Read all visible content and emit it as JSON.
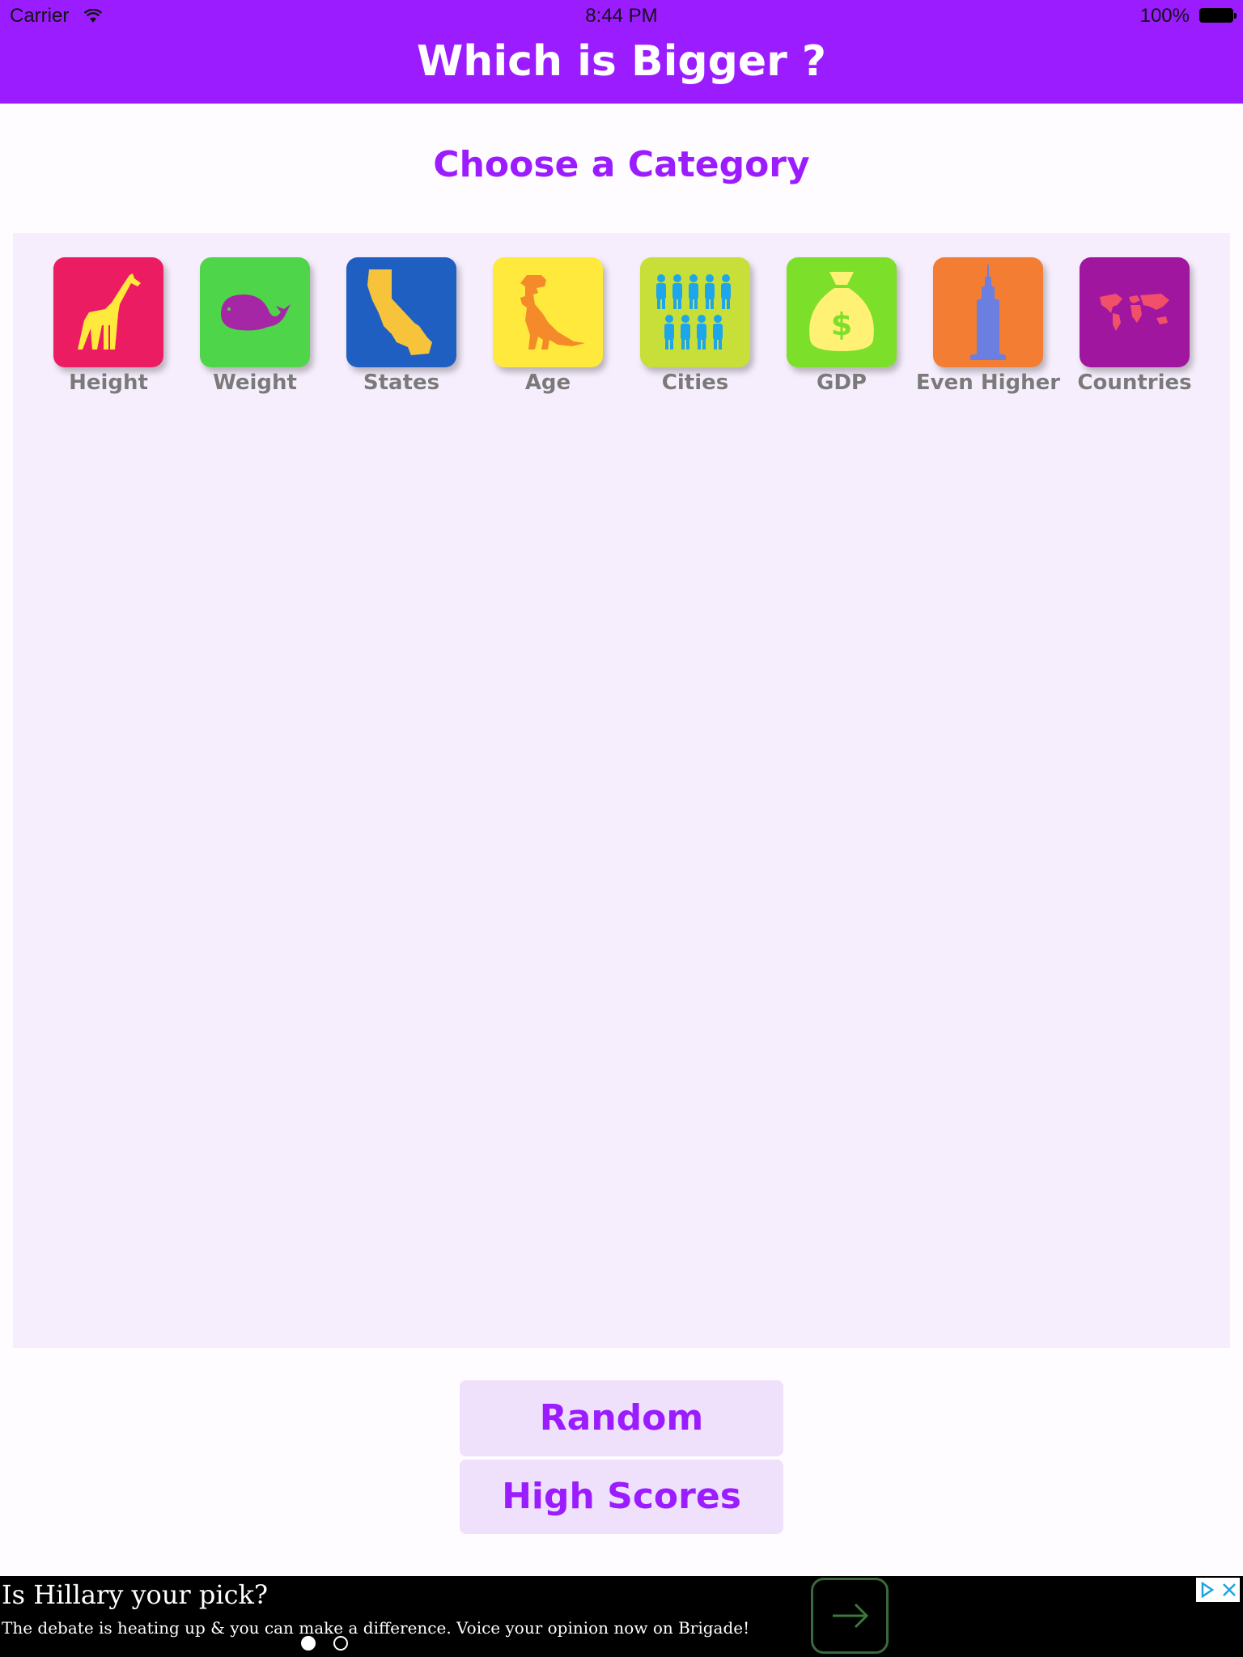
{
  "status_bar": {
    "carrier": "Carrier",
    "time": "8:44 PM",
    "battery": "100%"
  },
  "header": {
    "title": "Which is Bigger ?"
  },
  "subtitle": "Choose a Category",
  "categories": [
    {
      "label": "Height",
      "icon": "giraffe-icon",
      "color": "#ec1c63"
    },
    {
      "label": "Weight",
      "icon": "whale-icon",
      "color": "#4fd54a"
    },
    {
      "label": "States",
      "icon": "california-icon",
      "color": "#1f5fc2"
    },
    {
      "label": "Age",
      "icon": "dinosaur-icon",
      "color": "#ffe93c"
    },
    {
      "label": "Cities",
      "icon": "people-icon",
      "color": "#c8df3a"
    },
    {
      "label": "GDP",
      "icon": "money-bag-icon",
      "color": "#7ce02a"
    },
    {
      "label": "Even Higher",
      "icon": "skyscraper-icon",
      "color": "#f37e33"
    },
    {
      "label": "Countries",
      "icon": "world-map-icon",
      "color": "#a1169f"
    }
  ],
  "buttons": {
    "random": "Random",
    "high_scores": "High Scores"
  },
  "ad": {
    "headline": "Is Hillary your pick?",
    "body": "The debate is heating up & you can make a difference. Voice your opinion now on Brigade!"
  },
  "colors": {
    "brand": "#9b1cff",
    "panel": "#f6eefc",
    "button_bg": "#efe0fc"
  }
}
